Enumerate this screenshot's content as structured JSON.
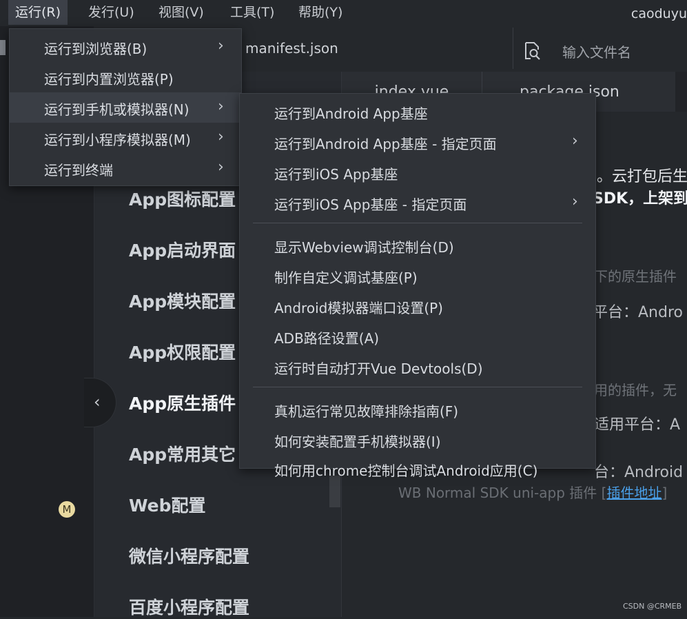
{
  "menubar": {
    "items": [
      "运行(R)",
      "发行(U)",
      "视图(V)",
      "工具(T)",
      "帮助(Y)"
    ],
    "user": "caoduyu"
  },
  "header": {
    "file_title": "manifest.json",
    "search_placeholder": "输入文件名",
    "tabs": [
      "index.vue",
      "package.json"
    ]
  },
  "sidenav": {
    "items": [
      "App图标配置",
      "App启动界面",
      "App模块配置",
      "App权限配置",
      "App原生插件",
      "App常用其它",
      "Web配置",
      "微信小程序配置",
      "百度小程序配置"
    ],
    "active_index": 4
  },
  "content": {
    "lines": [
      "。云打包后生",
      "SDK，上架到",
      "读下的原生插件",
      "平台：Andro",
      "用的插件，无",
      "适用平台：A",
      "台：Android",
      "WB Normal SDK uni-app 插件 ["
    ],
    "link": "插件地址",
    "link_suffix": "]"
  },
  "run_menu": {
    "items": [
      {
        "label": "运行到浏览器(B)",
        "submenu": true
      },
      {
        "label": "运行到内置浏览器(P)",
        "submenu": false
      },
      {
        "label": "运行到手机或模拟器(N)",
        "submenu": true
      },
      {
        "label": "运行到小程序模拟器(M)",
        "submenu": true
      },
      {
        "label": "运行到终端",
        "submenu": true
      }
    ],
    "highlighted_index": 2
  },
  "device_submenu": {
    "groups": [
      [
        {
          "label": "运行到Android App基座",
          "submenu": false
        },
        {
          "label": "运行到Android App基座 - 指定页面",
          "submenu": true
        },
        {
          "label": "运行到iOS App基座",
          "submenu": false
        },
        {
          "label": "运行到iOS App基座 - 指定页面",
          "submenu": true
        }
      ],
      [
        {
          "label": "显示Webview调试控制台(D)",
          "submenu": false
        },
        {
          "label": "制作自定义调试基座(P)",
          "submenu": false
        },
        {
          "label": "Android模拟器端口设置(P)",
          "submenu": false
        },
        {
          "label": "ADB路径设置(A)",
          "submenu": false
        },
        {
          "label": "运行时自动打开Vue Devtools(D)",
          "submenu": false
        }
      ],
      [
        {
          "label": "真机运行常见故障排除指南(F)",
          "submenu": false
        },
        {
          "label": "如何安装配置手机模拟器(I)",
          "submenu": false
        },
        {
          "label": "如何用chrome控制台调试Android应用(C)",
          "submenu": false
        }
      ]
    ]
  },
  "status": {
    "badge": "M",
    "watermark": "CSDN @CRMEB"
  },
  "icons": {
    "chevron_right": "›",
    "chevron_left": "‹",
    "search": "search-file-icon"
  },
  "colors": {
    "background": "#25282c",
    "menu_bg": "#2f3237",
    "menu_highlight": "#3a3e45",
    "link": "#4a9fe8"
  }
}
